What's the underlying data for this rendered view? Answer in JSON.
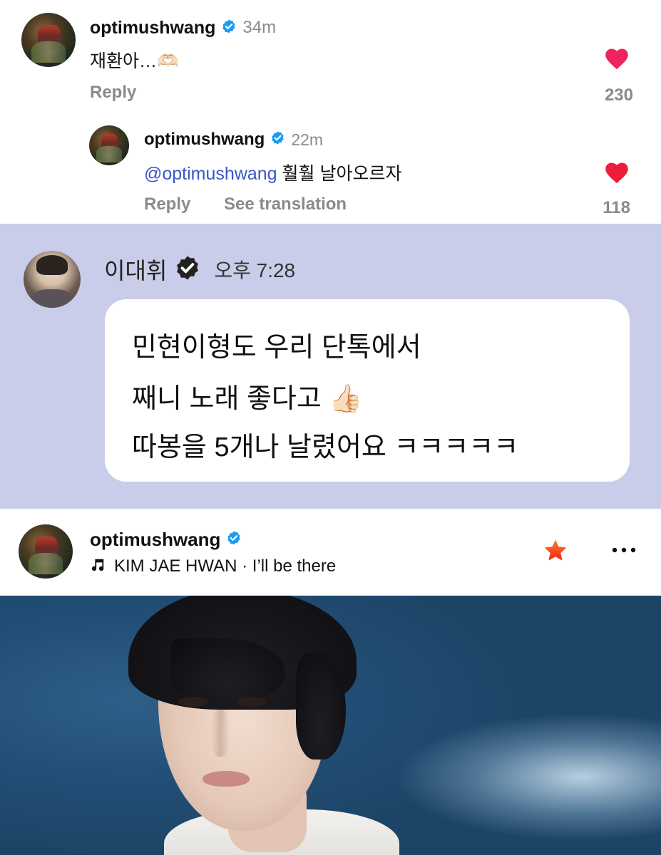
{
  "comment1": {
    "username": "optimushwang",
    "time": "34m",
    "text": "재환아…🫶🏻",
    "reply_label": "Reply",
    "like_count": "230",
    "like_color": "#f0245c"
  },
  "comment2": {
    "username": "optimushwang",
    "time": "22m",
    "mention": "@optimushwang",
    "text": "훨훨 날아오르자",
    "reply_label": "Reply",
    "translate_label": "See translation",
    "like_count": "118",
    "like_color": "#ee1d3b"
  },
  "chat": {
    "name": "이대휘",
    "time": "오후 7:28",
    "lines": [
      "민현이형도 우리 단톡에서",
      "째니 노래 좋다고 👍🏻",
      "따봉을 5개나 날렸어요 ㅋㅋㅋㅋㅋ"
    ],
    "background": "#c9cde9"
  },
  "post": {
    "username": "optimushwang",
    "music_icon": "music-note-icon",
    "music": "KIM JAE HWAN · I’ll be there",
    "star_icon": "star-icon",
    "more_icon": "more-icon",
    "star_color": "#f04a1e",
    "verified_color": "#1d9bf0"
  }
}
